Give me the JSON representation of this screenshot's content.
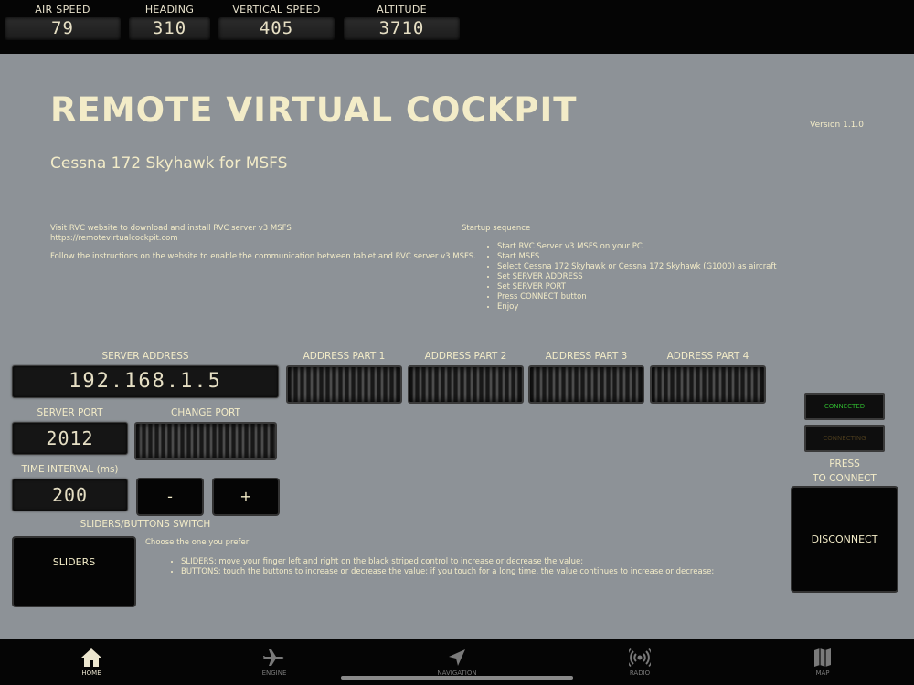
{
  "gauges": [
    {
      "label": "AIR SPEED",
      "value": "79"
    },
    {
      "label": "HEADING",
      "value": "310"
    },
    {
      "label": "VERTICAL SPEED",
      "value": "405"
    },
    {
      "label": "ALTITUDE",
      "value": "3710"
    }
  ],
  "header": {
    "title": "REMOTE VIRTUAL COCKPIT",
    "subtitle": "Cessna 172 Skyhawk for MSFS",
    "version": "Version 1.1.0"
  },
  "info": {
    "visit": "Visit RVC website to download and install RVC server v3 MSFS",
    "url": "https://remotevirtualcockpit.com",
    "follow": "Follow the instructions on the website to enable the communication between tablet and RVC server v3 MSFS."
  },
  "startup": {
    "title": "Startup sequence",
    "steps": [
      "Start RVC Server v3 MSFS on your PC",
      "Start MSFS",
      "Select Cessna 172 Skyhawk or Cessna 172 Skyhawk (G1000) as aircraft",
      "Set SERVER ADDRESS",
      "Set SERVER PORT",
      "Press CONNECT button",
      "Enjoy"
    ]
  },
  "server": {
    "address_label": "SERVER ADDRESS",
    "address_value": "192.168.1.5",
    "part_labels": [
      "ADDRESS PART 1",
      "ADDRESS PART 2",
      "ADDRESS PART 3",
      "ADDRESS PART 4"
    ],
    "port_label": "SERVER PORT",
    "port_value": "2012",
    "change_port_label": "CHANGE PORT",
    "interval_label": "TIME INTERVAL (ms)",
    "interval_value": "200",
    "minus_label": "-",
    "plus_label": "+"
  },
  "switch": {
    "label": "SLIDERS/BUTTONS SWITCH",
    "button_label": "SLIDERS",
    "choose_text": "Choose the one you prefer",
    "options": [
      "SLIDERS: move your finger left and right on the black striped control to increase or decrease the value;",
      "BUTTONS: touch the buttons to increase or decrease the value; if you touch for a long time, the value continues to increase or decrease;"
    ]
  },
  "connection": {
    "connected_label": "CONNECTED",
    "connected_color": "#2fb52f",
    "connecting_label": "CONNECTING",
    "connecting_color": "#4a3b1c",
    "press_line1": "PRESS",
    "press_line2": "TO CONNECT",
    "disconnect_label": "DISCONNECT"
  },
  "tabs": [
    {
      "label": "HOME",
      "icon": "home-icon",
      "active": true
    },
    {
      "label": "ENGINE",
      "icon": "airplane-icon",
      "active": false
    },
    {
      "label": "NAVIGATION",
      "icon": "navigation-arrow-icon",
      "active": false
    },
    {
      "label": "RADIO",
      "icon": "radio-waves-icon",
      "active": false
    },
    {
      "label": "MAP",
      "icon": "map-icon",
      "active": false
    }
  ]
}
